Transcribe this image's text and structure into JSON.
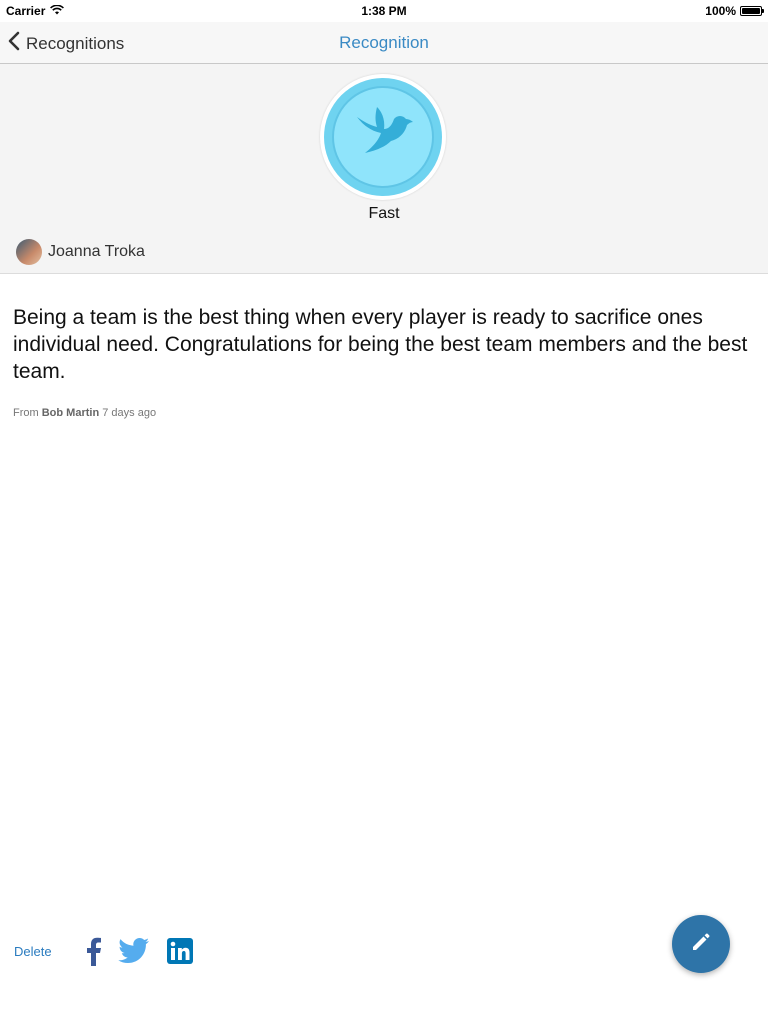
{
  "status_bar": {
    "carrier": "Carrier",
    "time": "1:38 PM",
    "battery": "100%"
  },
  "nav": {
    "back_label": "Recognitions",
    "title": "Recognition"
  },
  "badge": {
    "name": "Fast",
    "icon": "dove-icon"
  },
  "recipient": {
    "name": "Joanna Troka"
  },
  "message": {
    "text": "Being a team is the best thing when every player is ready to sacrifice ones individual need. Congratulations for being the best team members and the best team.",
    "from_prefix": "From",
    "from_name": "Bob Martin",
    "time_ago": "7 days ago"
  },
  "actions": {
    "delete_label": "Delete",
    "share_icons": [
      "facebook-icon",
      "twitter-icon",
      "linkedin-icon"
    ],
    "fab_icon": "pencil-icon"
  },
  "colors": {
    "accent": "#3a8ac4",
    "badge": "#8fe4fb",
    "fab": "#2e74a8",
    "facebook": "#3b5998",
    "twitter": "#55acee",
    "linkedin": "#0077b5"
  }
}
